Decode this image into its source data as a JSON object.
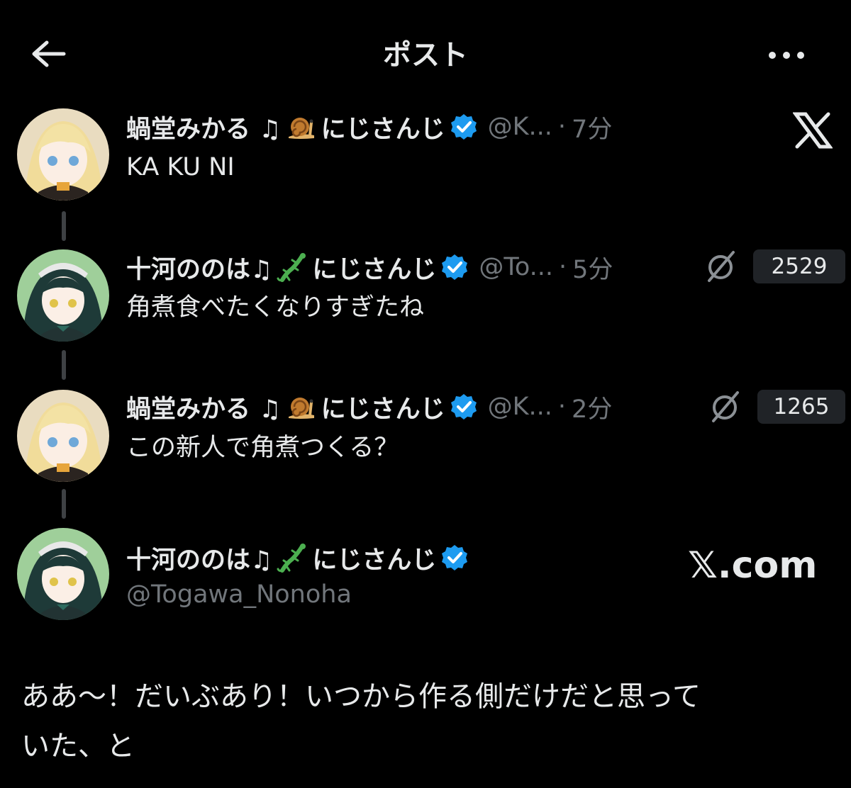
{
  "header": {
    "title": "ポスト",
    "back_icon": "arrow-left-icon",
    "more_icon": "more-horizontal-icon"
  },
  "thread": [
    {
      "display_name": "蝸堂みかる ♫",
      "name_suffix": "にじさんじ",
      "emoji": "snail-emoji",
      "handle": "@K...",
      "dot": "·",
      "time": "7分",
      "text": "KA KU NI",
      "right_icon": "x-logo-icon"
    },
    {
      "display_name": "十河ののは♫",
      "name_suffix": "にじさんじ",
      "emoji": "lizard-emoji",
      "handle": "@To...",
      "dot": "·",
      "time": "5分",
      "text": "角煮食べたくなりすぎたね",
      "count": "2529",
      "right_icon": "grok-icon"
    },
    {
      "display_name": "蝸堂みかる ♫",
      "name_suffix": "にじさんじ",
      "emoji": "snail-emoji",
      "handle": "@K...",
      "dot": "·",
      "time": "2分",
      "text": "この新人で角煮つくる？",
      "count": "1265",
      "right_icon": "grok-icon"
    }
  ],
  "main_post": {
    "display_name": "十河ののは♫",
    "name_suffix": "にじさんじ",
    "emoji": "lizard-emoji",
    "handle": "@Togawa_Nonoha",
    "text_line1": "ああ～！だいぶあり！いつから作る側だけだと思って",
    "text_line2": "いた、と",
    "watermark": "𝕏.com"
  },
  "colors": {
    "background": "#000000",
    "text": "#e7e9ea",
    "secondary": "#71767b",
    "verified": "#1d9bf0",
    "thread_line": "#3e4144",
    "badge_bg": "#202327"
  }
}
